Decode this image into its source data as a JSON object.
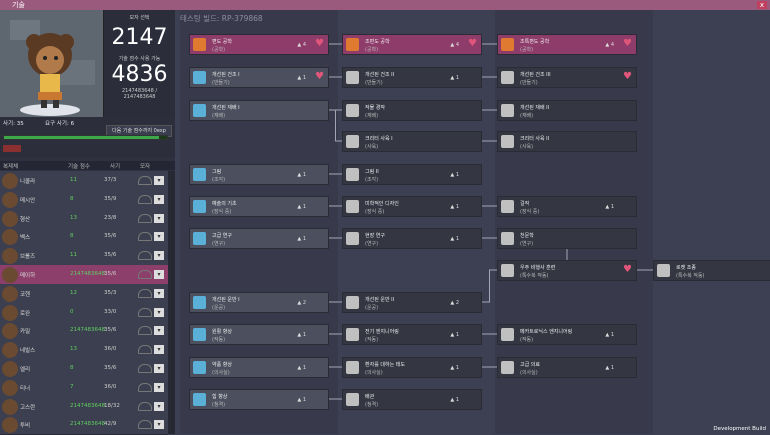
{
  "window": {
    "title": "기술",
    "close": "x"
  },
  "stats": {
    "label1": "모자 선택",
    "value1": "2147",
    "label2": "기술 점수 사용 가능",
    "value2": "4836",
    "detail1": "2147483648 /",
    "detail2": "2147483648"
  },
  "exp": {
    "morale": "사기: 35",
    "req_morale": "요구 사기: 6",
    "learn_button": "다음 기술 점수까지 0exp",
    "progress": 0.95
  },
  "columns": [
    "복제체",
    "기술 점수",
    "사기",
    "모자"
  ],
  "dupes": [
    {
      "name": "니콜라",
      "skill": "11",
      "exp": "37/3"
    },
    {
      "name": "메시안",
      "skill": "8",
      "exp": "35/9"
    },
    {
      "name": "형산",
      "skill": "13",
      "exp": "23/8"
    },
    {
      "name": "벡스",
      "skill": "8",
      "exp": "35/6"
    },
    {
      "name": "브롤즈",
      "skill": "11",
      "exp": "35/6"
    },
    {
      "name": "메이하",
      "skill": "2147483648",
      "exp": "35/6"
    },
    {
      "name": "코헨",
      "skill": "12",
      "exp": "35/3"
    },
    {
      "name": "로완",
      "skill": "0",
      "exp": "33/0"
    },
    {
      "name": "카밀",
      "skill": "2147483648",
      "exp": "35/6"
    },
    {
      "name": "네빌스",
      "skill": "13",
      "exp": "36/0"
    },
    {
      "name": "엘리",
      "skill": "8",
      "exp": "35/6"
    },
    {
      "name": "티너",
      "skill": "7",
      "exp": "36/0"
    },
    {
      "name": "고스란",
      "skill": "2147483648",
      "exp": "18/32"
    },
    {
      "name": "투비",
      "skill": "2147483648",
      "exp": "42/9"
    }
  ],
  "build_label": "테스팅 빌드: RP-379868",
  "dev_build": "Development Build",
  "nodes": [
    {
      "t1": "편도 공학",
      "t2": "(공학)",
      "cnt": "4",
      "heart": true,
      "state": "focus"
    },
    {
      "t1": "조편도 공학",
      "t2": "(공학)",
      "cnt": "4",
      "heart": true,
      "state": "focus"
    },
    {
      "t1": "조특편도 공학",
      "t2": "(공학)",
      "cnt": "4",
      "heart": true,
      "state": "focus"
    },
    {
      "t1": "개선된 건조 I",
      "t2": "(만들기)",
      "cnt": "1",
      "heart": true,
      "state": "norm"
    },
    {
      "t1": "개선된 건조 II",
      "t2": "(만들기)",
      "cnt": "1",
      "heart": false,
      "state": "done"
    },
    {
      "t1": "개선된 건조 III",
      "t2": "(만들기)",
      "cnt": "",
      "heart": true,
      "state": "done"
    },
    {
      "t1": "개선된 재배 I",
      "t2": "(재배)",
      "cnt": "",
      "heart": false,
      "state": "norm"
    },
    {
      "t1": "작물 경작",
      "t2": "(재배)",
      "cnt": "",
      "heart": false,
      "state": "done"
    },
    {
      "t1": "개선된 재배 II",
      "t2": "(재배)",
      "cnt": "",
      "heart": false,
      "state": "done"
    },
    {
      "t1": "크리터 사육 I",
      "t2": "(사육)",
      "cnt": "",
      "heart": false,
      "state": "done"
    },
    {
      "t1": "크리터 사육 II",
      "t2": "(사육)",
      "cnt": "",
      "heart": false,
      "state": "done"
    },
    {
      "t1": "그림",
      "t2": "(조각)",
      "cnt": "1",
      "heart": false,
      "state": "norm"
    },
    {
      "t1": "그림 II",
      "t2": "(조각)",
      "cnt": "1",
      "heart": false,
      "state": "done"
    },
    {
      "t1": "예술의 기초",
      "t2": "(장식 중)",
      "cnt": "1",
      "heart": false,
      "state": "norm"
    },
    {
      "t1": "미학적인 디자인",
      "t2": "(장식 중)",
      "cnt": "1",
      "heart": false,
      "state": "done"
    },
    {
      "t1": "걸작",
      "t2": "(장식 중)",
      "cnt": "1",
      "heart": false,
      "state": "done"
    },
    {
      "t1": "고급 연구",
      "t2": "(연구)",
      "cnt": "1",
      "heart": false,
      "state": "norm"
    },
    {
      "t1": "현장 연구",
      "t2": "(연구)",
      "cnt": "1",
      "heart": false,
      "state": "done"
    },
    {
      "t1": "천문학",
      "t2": "(연구)",
      "cnt": "",
      "heart": false,
      "state": "done"
    },
    {
      "t1": "우주 비행사 훈련",
      "t2": "(특수복 작동)",
      "cnt": "",
      "heart": true,
      "state": "done"
    },
    {
      "t1": "로켓 조종",
      "t2": "(특수복 작동)",
      "cnt": "",
      "heart": false,
      "state": "done"
    },
    {
      "t1": "개선된 운반 I",
      "t2": "(운공)",
      "cnt": "2",
      "heart": false,
      "state": "norm"
    },
    {
      "t1": "개선된 운반 II",
      "t2": "(운공)",
      "cnt": "2",
      "heart": false,
      "state": "done"
    },
    {
      "t1": "원활 향상",
      "t2": "(작동)",
      "cnt": "1",
      "heart": false,
      "state": "norm"
    },
    {
      "t1": "전기 엔지니어링",
      "t2": "(작동)",
      "cnt": "1",
      "heart": false,
      "state": "done"
    },
    {
      "t1": "메카트로닉스 엔지니어링",
      "t2": "(작동)",
      "cnt": "1",
      "heart": false,
      "state": "done"
    },
    {
      "t1": "약품 향상",
      "t2": "(의사실)",
      "cnt": "1",
      "heart": false,
      "state": "norm"
    },
    {
      "t1": "환자를 대하는 태도",
      "t2": "(의사실)",
      "cnt": "1",
      "heart": false,
      "state": "done"
    },
    {
      "t1": "고급 의료",
      "t2": "(의사실)",
      "cnt": "1",
      "heart": false,
      "state": "done"
    },
    {
      "t1": "힘 향상",
      "t2": "(청격)",
      "cnt": "1",
      "heart": false,
      "state": "norm"
    },
    {
      "t1": "배관",
      "t2": "(청격)",
      "cnt": "1",
      "heart": false,
      "state": "done"
    }
  ]
}
